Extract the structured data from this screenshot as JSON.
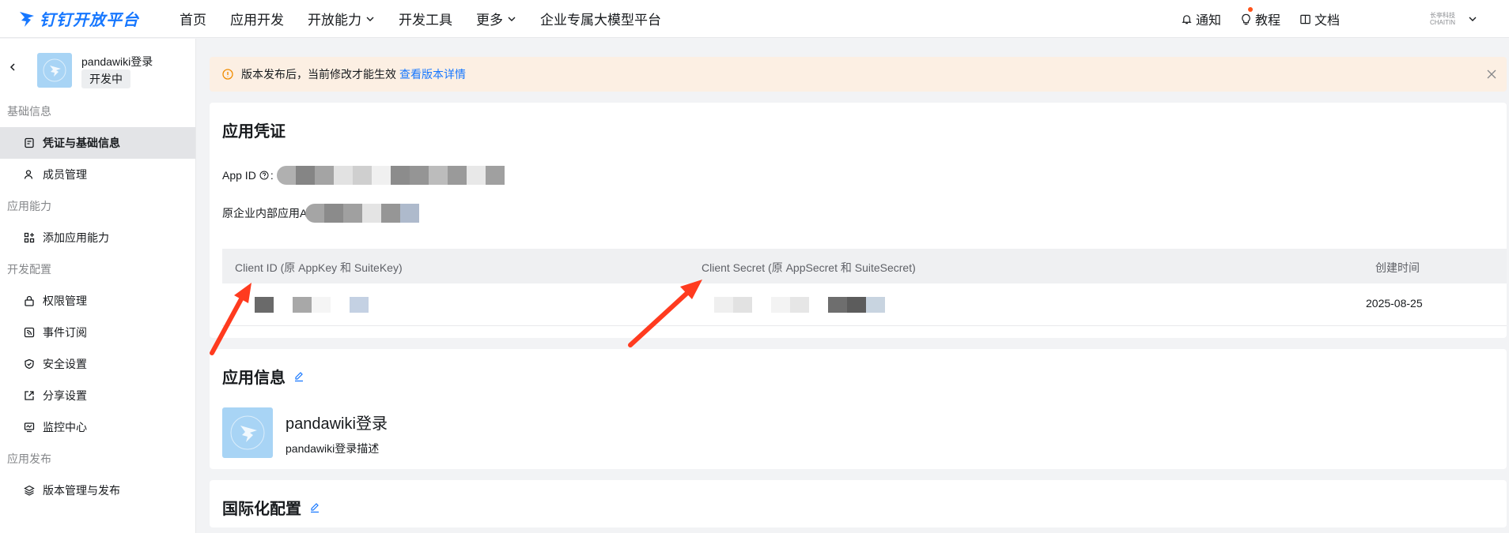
{
  "topbar": {
    "logo_text": "钉钉开放平台",
    "nav": [
      "首页",
      "应用开发",
      "开放能力",
      "开发工具",
      "更多",
      "企业专属大模型平台"
    ],
    "notify": "通知",
    "tutorial": "教程",
    "docs": "文档",
    "company_logo_line1": "长亭科技",
    "company_logo_line2": "CHAITIN"
  },
  "sidebar": {
    "app_name": "pandawiki登录",
    "status": "开发中",
    "groups": [
      {
        "title": "基础信息",
        "items": [
          "凭证与基础信息",
          "成员管理"
        ]
      },
      {
        "title": "应用能力",
        "items": [
          "添加应用能力"
        ]
      },
      {
        "title": "开发配置",
        "items": [
          "权限管理",
          "事件订阅",
          "安全设置",
          "分享设置",
          "监控中心"
        ]
      },
      {
        "title": "应用发布",
        "items": [
          "版本管理与发布"
        ]
      }
    ]
  },
  "alert": {
    "text": "版本发布后，当前修改才能生效",
    "link": "查看版本详情"
  },
  "credentials": {
    "title": "应用凭证",
    "app_id_label": "App ID",
    "legacy_label": "原企业内部应用A",
    "table_headers": [
      "Client ID (原 AppKey 和 SuiteKey)",
      "Client Secret (原 AppSecret 和 SuiteSecret)",
      "创建时间"
    ],
    "created": "2025-08-25"
  },
  "app_info": {
    "title": "应用信息",
    "name": "pandawiki登录",
    "description": "pandawiki登录描述"
  },
  "i18n": {
    "title": "国际化配置"
  },
  "colors": {
    "brand": "#1677ff",
    "alert_bg": "#fcefe3",
    "annotation_arrow": "#ff3b1f"
  }
}
